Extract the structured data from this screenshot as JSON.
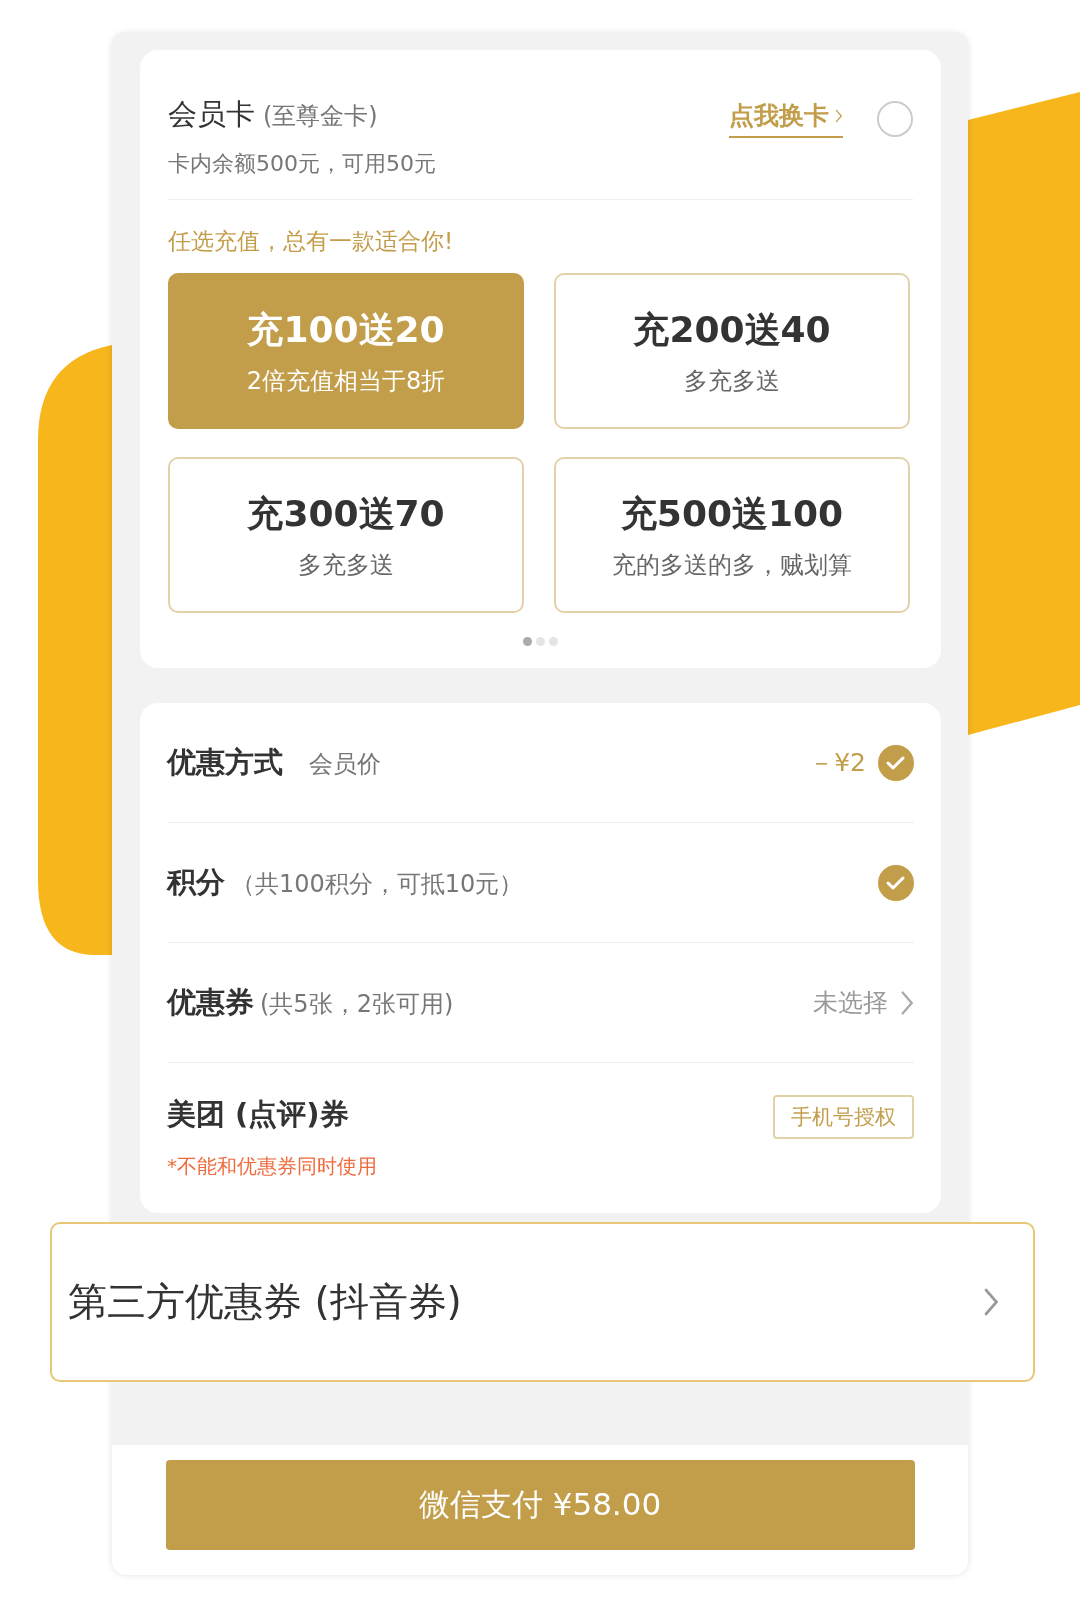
{
  "member_card": {
    "title": "会员卡",
    "subtitle": "(至尊金卡)",
    "balance": "卡内余额500元，可用50元",
    "switch_link": "点我换卡",
    "selected": false
  },
  "recharge_hint": "任选充值，总有一款适合你!",
  "plans": [
    {
      "title": "充100送20",
      "subtitle": "2倍充值相当于8折",
      "selected": true
    },
    {
      "title": "充200送40",
      "subtitle": "多充多送",
      "selected": false
    },
    {
      "title": "充300送70",
      "subtitle": "多充多送",
      "selected": false
    },
    {
      "title": "充500送100",
      "subtitle": "充的多送的多，贼划算",
      "selected": false
    }
  ],
  "pager": [
    {
      "selected": true
    },
    {
      "selected": false
    },
    {
      "selected": false
    }
  ],
  "discounts": [
    {
      "kind": "check",
      "label": "优惠方式",
      "detail": "会员价",
      "value": "－¥2",
      "checked": true
    },
    {
      "kind": "check",
      "label": "积分",
      "detail": "（共100积分，可抵10元）",
      "checked": true
    },
    {
      "kind": "link",
      "label": "优惠券",
      "detail": "(共5张，2张可用)",
      "value": "未选择"
    },
    {
      "kind": "auth",
      "label": "美团 (点评)券",
      "note": "*不能和优惠券同时使用",
      "button": "手机号授权"
    }
  ],
  "third_party": {
    "label": "第三方优惠券 (抖音券)"
  },
  "pay_button": "微信支付 ¥58.00"
}
